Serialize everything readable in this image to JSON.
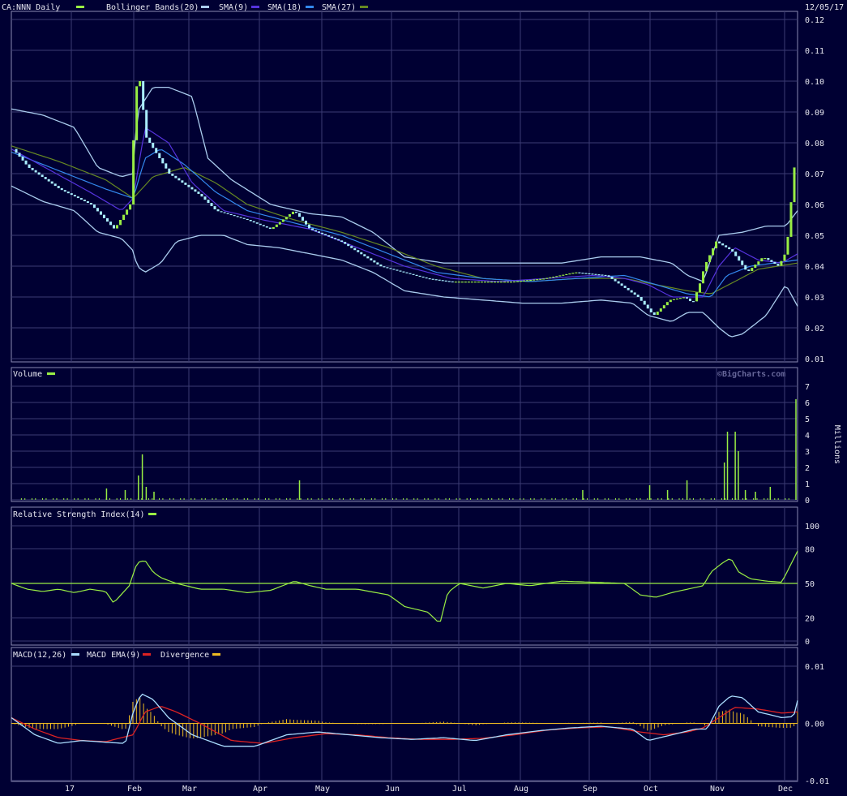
{
  "header": {
    "symbol_label": "CA:NNN Daily",
    "date": "12/05/17",
    "watermark": "©BigCharts.com"
  },
  "colors": {
    "background": "#000033",
    "grid": "#3b3b73",
    "frame": "#8a8ab0",
    "text": "#e6e6f0",
    "price_up": "#99ee44",
    "price_down": "#aaeeff",
    "bollinger": "#aaccee",
    "sma9": "#5533dd",
    "sma18": "#3388ee",
    "sma27": "#668822",
    "volume": "#99ee44",
    "rsi": "#99ee44",
    "macd": "#aaddff",
    "macd_ema": "#dd2222",
    "divergence": "#eebb22"
  },
  "legend": {
    "bollinger": "Bollinger Bands(20)",
    "sma9": "SMA(9)",
    "sma18": "SMA(18)",
    "sma27": "SMA(27)",
    "volume": "Volume",
    "rsi": "Relative Strength Index(14)",
    "macd": "MACD(12,26)",
    "macd_ema": "MACD EMA(9)",
    "divergence": "Divergence"
  },
  "x_axis": {
    "month_labels": [
      "17",
      "Feb",
      "Mar",
      "Apr",
      "May",
      "Jun",
      "Jul",
      "Aug",
      "Sep",
      "Oct",
      "Nov",
      "Dec"
    ]
  },
  "chart_data": [
    {
      "type": "line",
      "panel": "price",
      "title": "CA:NNN Daily",
      "y_ticks": [
        "0.12",
        "0.11",
        "0.10",
        "0.09",
        "0.08",
        "0.07",
        "0.06",
        "0.05",
        "0.04",
        "0.03",
        "0.02",
        "0.01"
      ],
      "ylim": [
        0.01,
        0.12
      ],
      "close_anchors": {
        "x": [
          0,
          0.02,
          0.06,
          0.1,
          0.13,
          0.15,
          0.155,
          0.16,
          0.165,
          0.17,
          0.18,
          0.2,
          0.24,
          0.26,
          0.3,
          0.33,
          0.36,
          0.38,
          0.42,
          0.47,
          0.5,
          0.53,
          0.56,
          0.6,
          0.64,
          0.68,
          0.72,
          0.76,
          0.8,
          0.82,
          0.84,
          0.86,
          0.87,
          0.88,
          0.885,
          0.9,
          0.92,
          0.94,
          0.96,
          0.98,
          0.99,
          1.0
        ],
        "y": [
          0.078,
          0.072,
          0.065,
          0.06,
          0.052,
          0.06,
          0.085,
          0.105,
          0.095,
          0.082,
          0.078,
          0.07,
          0.063,
          0.058,
          0.055,
          0.052,
          0.058,
          0.052,
          0.048,
          0.04,
          0.038,
          0.036,
          0.035,
          0.035,
          0.035,
          0.036,
          0.038,
          0.037,
          0.03,
          0.024,
          0.029,
          0.03,
          0.028,
          0.035,
          0.04,
          0.048,
          0.045,
          0.038,
          0.043,
          0.04,
          0.045,
          0.072
        ]
      },
      "bollinger_upper_anchors": {
        "x": [
          0,
          0.04,
          0.08,
          0.11,
          0.14,
          0.155,
          0.16,
          0.18,
          0.2,
          0.23,
          0.25,
          0.28,
          0.33,
          0.38,
          0.42,
          0.46,
          0.5,
          0.55,
          0.6,
          0.65,
          0.7,
          0.75,
          0.8,
          0.84,
          0.86,
          0.88,
          0.9,
          0.93,
          0.96,
          0.985,
          1.0
        ],
        "y": [
          0.091,
          0.089,
          0.085,
          0.072,
          0.069,
          0.07,
          0.09,
          0.098,
          0.098,
          0.095,
          0.075,
          0.068,
          0.06,
          0.057,
          0.056,
          0.051,
          0.043,
          0.041,
          0.041,
          0.041,
          0.041,
          0.043,
          0.043,
          0.041,
          0.037,
          0.035,
          0.05,
          0.051,
          0.053,
          0.053,
          0.058
        ]
      },
      "bollinger_lower_anchors": {
        "x": [
          0,
          0.04,
          0.08,
          0.11,
          0.14,
          0.155,
          0.16,
          0.17,
          0.19,
          0.21,
          0.24,
          0.27,
          0.3,
          0.34,
          0.38,
          0.42,
          0.46,
          0.5,
          0.55,
          0.6,
          0.65,
          0.7,
          0.75,
          0.79,
          0.81,
          0.84,
          0.86,
          0.88,
          0.9,
          0.915,
          0.93,
          0.96,
          0.985,
          1.0
        ],
        "y": [
          0.066,
          0.061,
          0.058,
          0.051,
          0.049,
          0.045,
          0.04,
          0.038,
          0.041,
          0.048,
          0.05,
          0.05,
          0.047,
          0.046,
          0.044,
          0.042,
          0.038,
          0.032,
          0.03,
          0.029,
          0.028,
          0.028,
          0.029,
          0.028,
          0.024,
          0.022,
          0.025,
          0.025,
          0.02,
          0.017,
          0.018,
          0.024,
          0.034,
          0.027
        ]
      },
      "sma9_anchors": {
        "x": [
          0,
          0.05,
          0.1,
          0.14,
          0.155,
          0.17,
          0.2,
          0.23,
          0.27,
          0.32,
          0.38,
          0.45,
          0.5,
          0.56,
          0.62,
          0.68,
          0.74,
          0.78,
          0.81,
          0.84,
          0.86,
          0.88,
          0.9,
          0.92,
          0.95,
          0.98,
          1.0
        ],
        "y": [
          0.078,
          0.071,
          0.064,
          0.058,
          0.062,
          0.085,
          0.08,
          0.067,
          0.058,
          0.055,
          0.052,
          0.045,
          0.04,
          0.036,
          0.035,
          0.036,
          0.037,
          0.036,
          0.034,
          0.03,
          0.03,
          0.03,
          0.04,
          0.046,
          0.042,
          0.041,
          0.044
        ]
      },
      "sma18_anchors": {
        "x": [
          0,
          0.06,
          0.12,
          0.155,
          0.17,
          0.19,
          0.22,
          0.26,
          0.3,
          0.36,
          0.42,
          0.48,
          0.54,
          0.6,
          0.66,
          0.72,
          0.78,
          0.82,
          0.86,
          0.89,
          0.91,
          0.94,
          0.97,
          1.0
        ],
        "y": [
          0.077,
          0.071,
          0.065,
          0.062,
          0.075,
          0.078,
          0.073,
          0.064,
          0.058,
          0.054,
          0.05,
          0.044,
          0.038,
          0.036,
          0.035,
          0.036,
          0.037,
          0.034,
          0.031,
          0.03,
          0.037,
          0.04,
          0.041,
          0.042
        ]
      },
      "sma27_anchors": {
        "x": [
          0,
          0.06,
          0.12,
          0.155,
          0.18,
          0.22,
          0.26,
          0.3,
          0.36,
          0.42,
          0.48,
          0.54,
          0.6,
          0.66,
          0.72,
          0.78,
          0.82,
          0.86,
          0.89,
          0.92,
          0.95,
          1.0
        ],
        "y": [
          0.079,
          0.074,
          0.068,
          0.062,
          0.069,
          0.072,
          0.067,
          0.06,
          0.055,
          0.051,
          0.046,
          0.04,
          0.036,
          0.035,
          0.036,
          0.036,
          0.034,
          0.032,
          0.031,
          0.035,
          0.039,
          0.041
        ]
      }
    },
    {
      "type": "bar",
      "panel": "volume",
      "title": "Volume",
      "ylabel": "Millions",
      "y_ticks": [
        "7",
        "6",
        "5",
        "4",
        "3",
        "2",
        "1",
        "0"
      ],
      "ylim": [
        0,
        7
      ],
      "spikes": [
        {
          "x": 0.114,
          "value": 0.7
        },
        {
          "x": 0.138,
          "value": 0.6
        },
        {
          "x": 0.155,
          "value": 1.5
        },
        {
          "x": 0.16,
          "value": 2.8
        },
        {
          "x": 0.165,
          "value": 0.8
        },
        {
          "x": 0.175,
          "value": 0.5
        },
        {
          "x": 0.362,
          "value": 1.2
        },
        {
          "x": 0.726,
          "value": 0.6
        },
        {
          "x": 0.812,
          "value": 0.9
        },
        {
          "x": 0.835,
          "value": 0.6
        },
        {
          "x": 0.86,
          "value": 1.2
        },
        {
          "x": 0.908,
          "value": 2.3
        },
        {
          "x": 0.912,
          "value": 4.2
        },
        {
          "x": 0.922,
          "value": 4.2
        },
        {
          "x": 0.926,
          "value": 3.0
        },
        {
          "x": 0.935,
          "value": 0.6
        },
        {
          "x": 0.948,
          "value": 0.5
        },
        {
          "x": 0.967,
          "value": 0.8
        },
        {
          "x": 1.0,
          "value": 6.2
        }
      ],
      "base_volume": 0.1
    },
    {
      "type": "line",
      "panel": "rsi",
      "title": "Relative Strength Index(14)",
      "y_ticks": [
        "100",
        "80",
        "50",
        "20",
        "0"
      ],
      "ylim": [
        0,
        100
      ],
      "reference": 50,
      "anchors": {
        "x": [
          0,
          0.02,
          0.04,
          0.06,
          0.08,
          0.1,
          0.12,
          0.13,
          0.15,
          0.16,
          0.17,
          0.18,
          0.19,
          0.21,
          0.24,
          0.27,
          0.3,
          0.33,
          0.36,
          0.38,
          0.4,
          0.44,
          0.48,
          0.5,
          0.53,
          0.545,
          0.555,
          0.57,
          0.6,
          0.63,
          0.66,
          0.7,
          0.74,
          0.78,
          0.8,
          0.82,
          0.84,
          0.86,
          0.88,
          0.89,
          0.905,
          0.915,
          0.925,
          0.94,
          0.96,
          0.98,
          1.0
        ],
        "y": [
          50,
          45,
          43,
          45,
          42,
          45,
          43,
          33,
          48,
          68,
          70,
          60,
          55,
          50,
          45,
          45,
          42,
          44,
          52,
          48,
          45,
          45,
          40,
          30,
          25,
          15,
          42,
          50,
          46,
          50,
          48,
          52,
          51,
          50,
          40,
          38,
          42,
          45,
          48,
          60,
          68,
          72,
          60,
          54,
          52,
          51,
          78
        ]
      }
    },
    {
      "type": "line",
      "panel": "macd",
      "title": "MACD(12,26)",
      "y_ticks": [
        "0.01",
        "0.00",
        "-0.01"
      ],
      "ylim": [
        -0.01,
        0.01
      ],
      "macd_anchors": {
        "x": [
          0,
          0.03,
          0.06,
          0.09,
          0.12,
          0.145,
          0.155,
          0.165,
          0.18,
          0.2,
          0.23,
          0.27,
          0.31,
          0.35,
          0.39,
          0.43,
          0.47,
          0.51,
          0.55,
          0.59,
          0.63,
          0.67,
          0.71,
          0.75,
          0.79,
          0.81,
          0.84,
          0.87,
          0.885,
          0.9,
          0.915,
          0.93,
          0.95,
          0.98,
          0.995,
          1.0
        ],
        "y": [
          0.001,
          -0.002,
          -0.0035,
          -0.003,
          -0.0033,
          -0.0035,
          0.002,
          0.0052,
          0.0042,
          0.001,
          -0.002,
          -0.004,
          -0.004,
          -0.002,
          -0.0015,
          -0.002,
          -0.0025,
          -0.0028,
          -0.0025,
          -0.003,
          -0.002,
          -0.0013,
          -0.0008,
          -0.0005,
          -0.001,
          -0.003,
          -0.002,
          -0.001,
          -0.001,
          0.003,
          0.0048,
          0.0045,
          0.002,
          0.001,
          0.0012,
          0.004
        ]
      },
      "ema_anchors": {
        "x": [
          0,
          0.03,
          0.06,
          0.09,
          0.12,
          0.155,
          0.17,
          0.19,
          0.21,
          0.24,
          0.28,
          0.32,
          0.36,
          0.4,
          0.44,
          0.48,
          0.52,
          0.56,
          0.6,
          0.64,
          0.68,
          0.72,
          0.76,
          0.8,
          0.83,
          0.86,
          0.88,
          0.9,
          0.92,
          0.95,
          0.98,
          1.0
        ],
        "y": [
          0.001,
          -0.001,
          -0.0025,
          -0.003,
          -0.0032,
          -0.002,
          0.002,
          0.003,
          0.002,
          0.0,
          -0.003,
          -0.0035,
          -0.0025,
          -0.0018,
          -0.002,
          -0.0025,
          -0.0028,
          -0.0028,
          -0.0026,
          -0.002,
          -0.0012,
          -0.0008,
          -0.0006,
          -0.0015,
          -0.002,
          -0.0015,
          -0.0008,
          0.001,
          0.0028,
          0.0025,
          0.0018,
          0.002
        ]
      }
    }
  ]
}
